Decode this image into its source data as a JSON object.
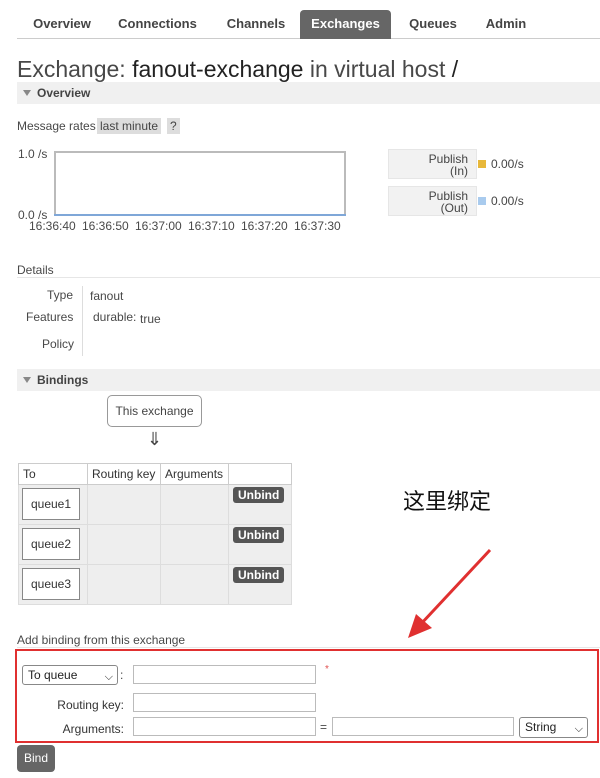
{
  "nav": {
    "tabs": [
      {
        "label": "Overview"
      },
      {
        "label": "Connections"
      },
      {
        "label": "Channels"
      },
      {
        "label": "Exchanges",
        "active": true
      },
      {
        "label": "Queues"
      },
      {
        "label": "Admin"
      }
    ]
  },
  "title": {
    "prefix": "Exchange:",
    "name": "fanout-exchange",
    "mid": "in virtual host",
    "vhost": "/"
  },
  "overview": {
    "header": "Overview",
    "message_rates_label": "Message rates",
    "period": "last minute",
    "help": "?",
    "chart": {
      "y_top": "1.0 /s",
      "y_bottom": "0.0 /s",
      "x_ticks": [
        "16:36:40",
        "16:36:50",
        "16:37:00",
        "16:37:10",
        "16:37:20",
        "16:37:30"
      ]
    },
    "legend": [
      {
        "line1": "Publish",
        "line2": "(In)",
        "value": "0.00/s",
        "color": "#e8b83a"
      },
      {
        "line1": "Publish",
        "line2": "(Out)",
        "value": "0.00/s",
        "color": "#a9cbee"
      }
    ]
  },
  "details": {
    "header": "Details",
    "rows": [
      {
        "label": "Type",
        "value": "fanout"
      },
      {
        "label": "Features",
        "key": "durable:",
        "value": "true"
      },
      {
        "label": "Policy",
        "value": ""
      }
    ]
  },
  "bindings": {
    "header": "Bindings",
    "this_exchange": "This exchange",
    "arrow": "⇓",
    "columns": [
      "To",
      "Routing key",
      "Arguments",
      ""
    ],
    "rows": [
      {
        "queue": "queue1",
        "routing_key": "",
        "arguments": "",
        "action": "Unbind"
      },
      {
        "queue": "queue2",
        "routing_key": "",
        "arguments": "",
        "action": "Unbind"
      },
      {
        "queue": "queue3",
        "routing_key": "",
        "arguments": "",
        "action": "Unbind"
      }
    ]
  },
  "annotation": {
    "note": "这里绑定",
    "arrow_color": "#e03030"
  },
  "add_binding": {
    "header": "Add binding from this exchange",
    "destination_select": "To queue",
    "colon": ":",
    "required_mark": "*",
    "routing_key_label": "Routing key:",
    "arguments_label": "Arguments:",
    "equals": "=",
    "type_select": "String",
    "submit": "Bind"
  }
}
